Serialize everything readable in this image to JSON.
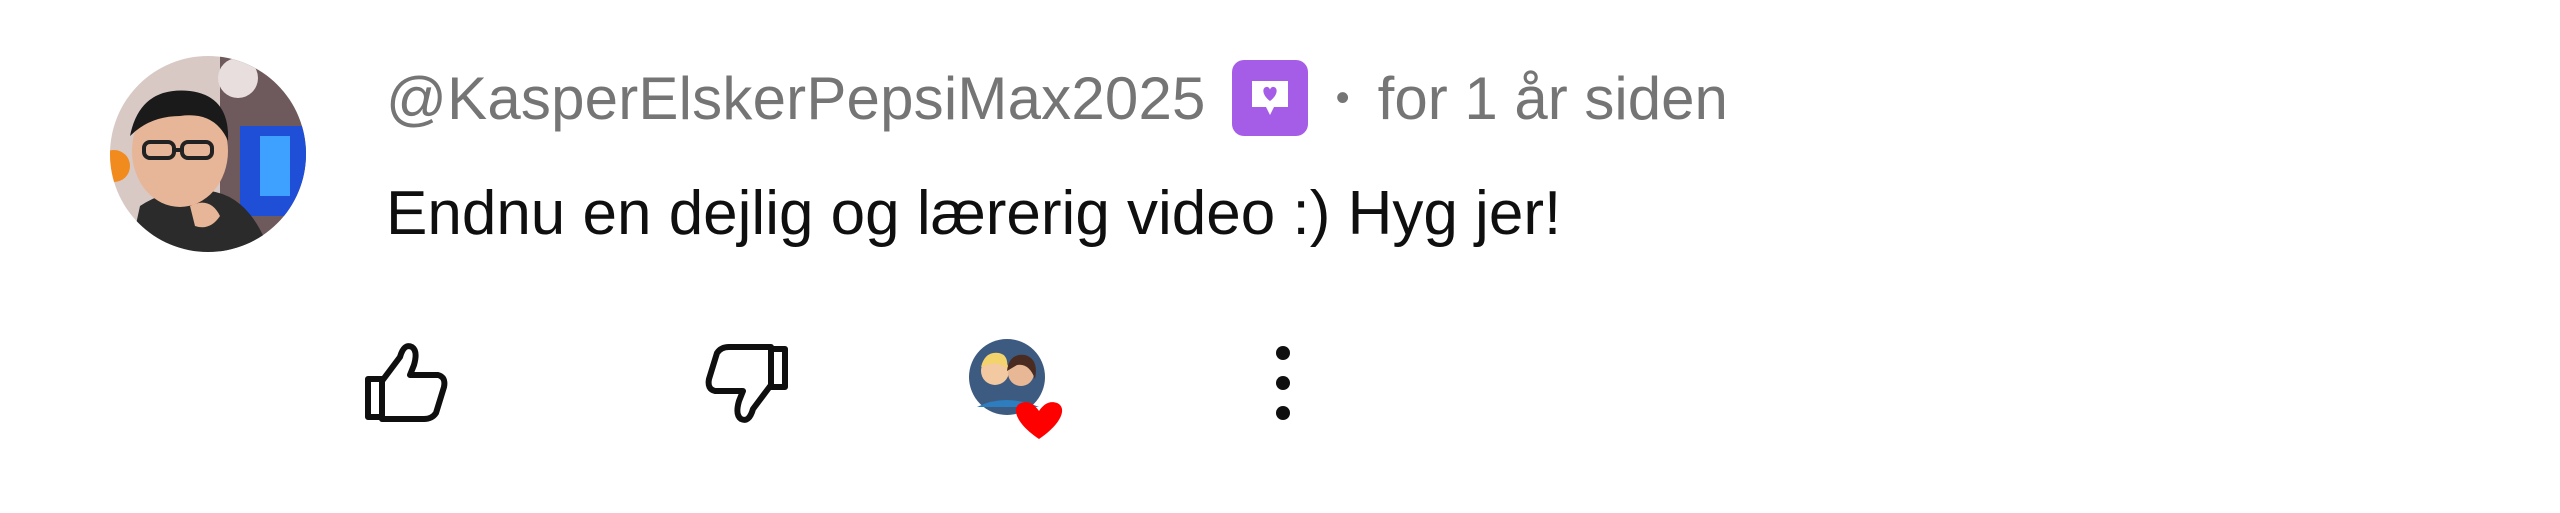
{
  "comment": {
    "username": "@KasperElskerPepsiMax2025",
    "member_badge_icon": "member-badge-icon",
    "separator": "•",
    "timestamp": "for 1 år siden",
    "text": "Endnu en dejlig og lærerig video :) Hyg jer!"
  },
  "actions": {
    "like_icon": "thumbs-up-icon",
    "dislike_icon": "thumbs-down-icon",
    "heart_icon": "creator-heart-icon",
    "more_icon": "more-vertical-icon"
  },
  "colors": {
    "username": "#757575",
    "text": "#0f0f0f",
    "badge": "#a55de8",
    "heart": "#ff0000"
  }
}
